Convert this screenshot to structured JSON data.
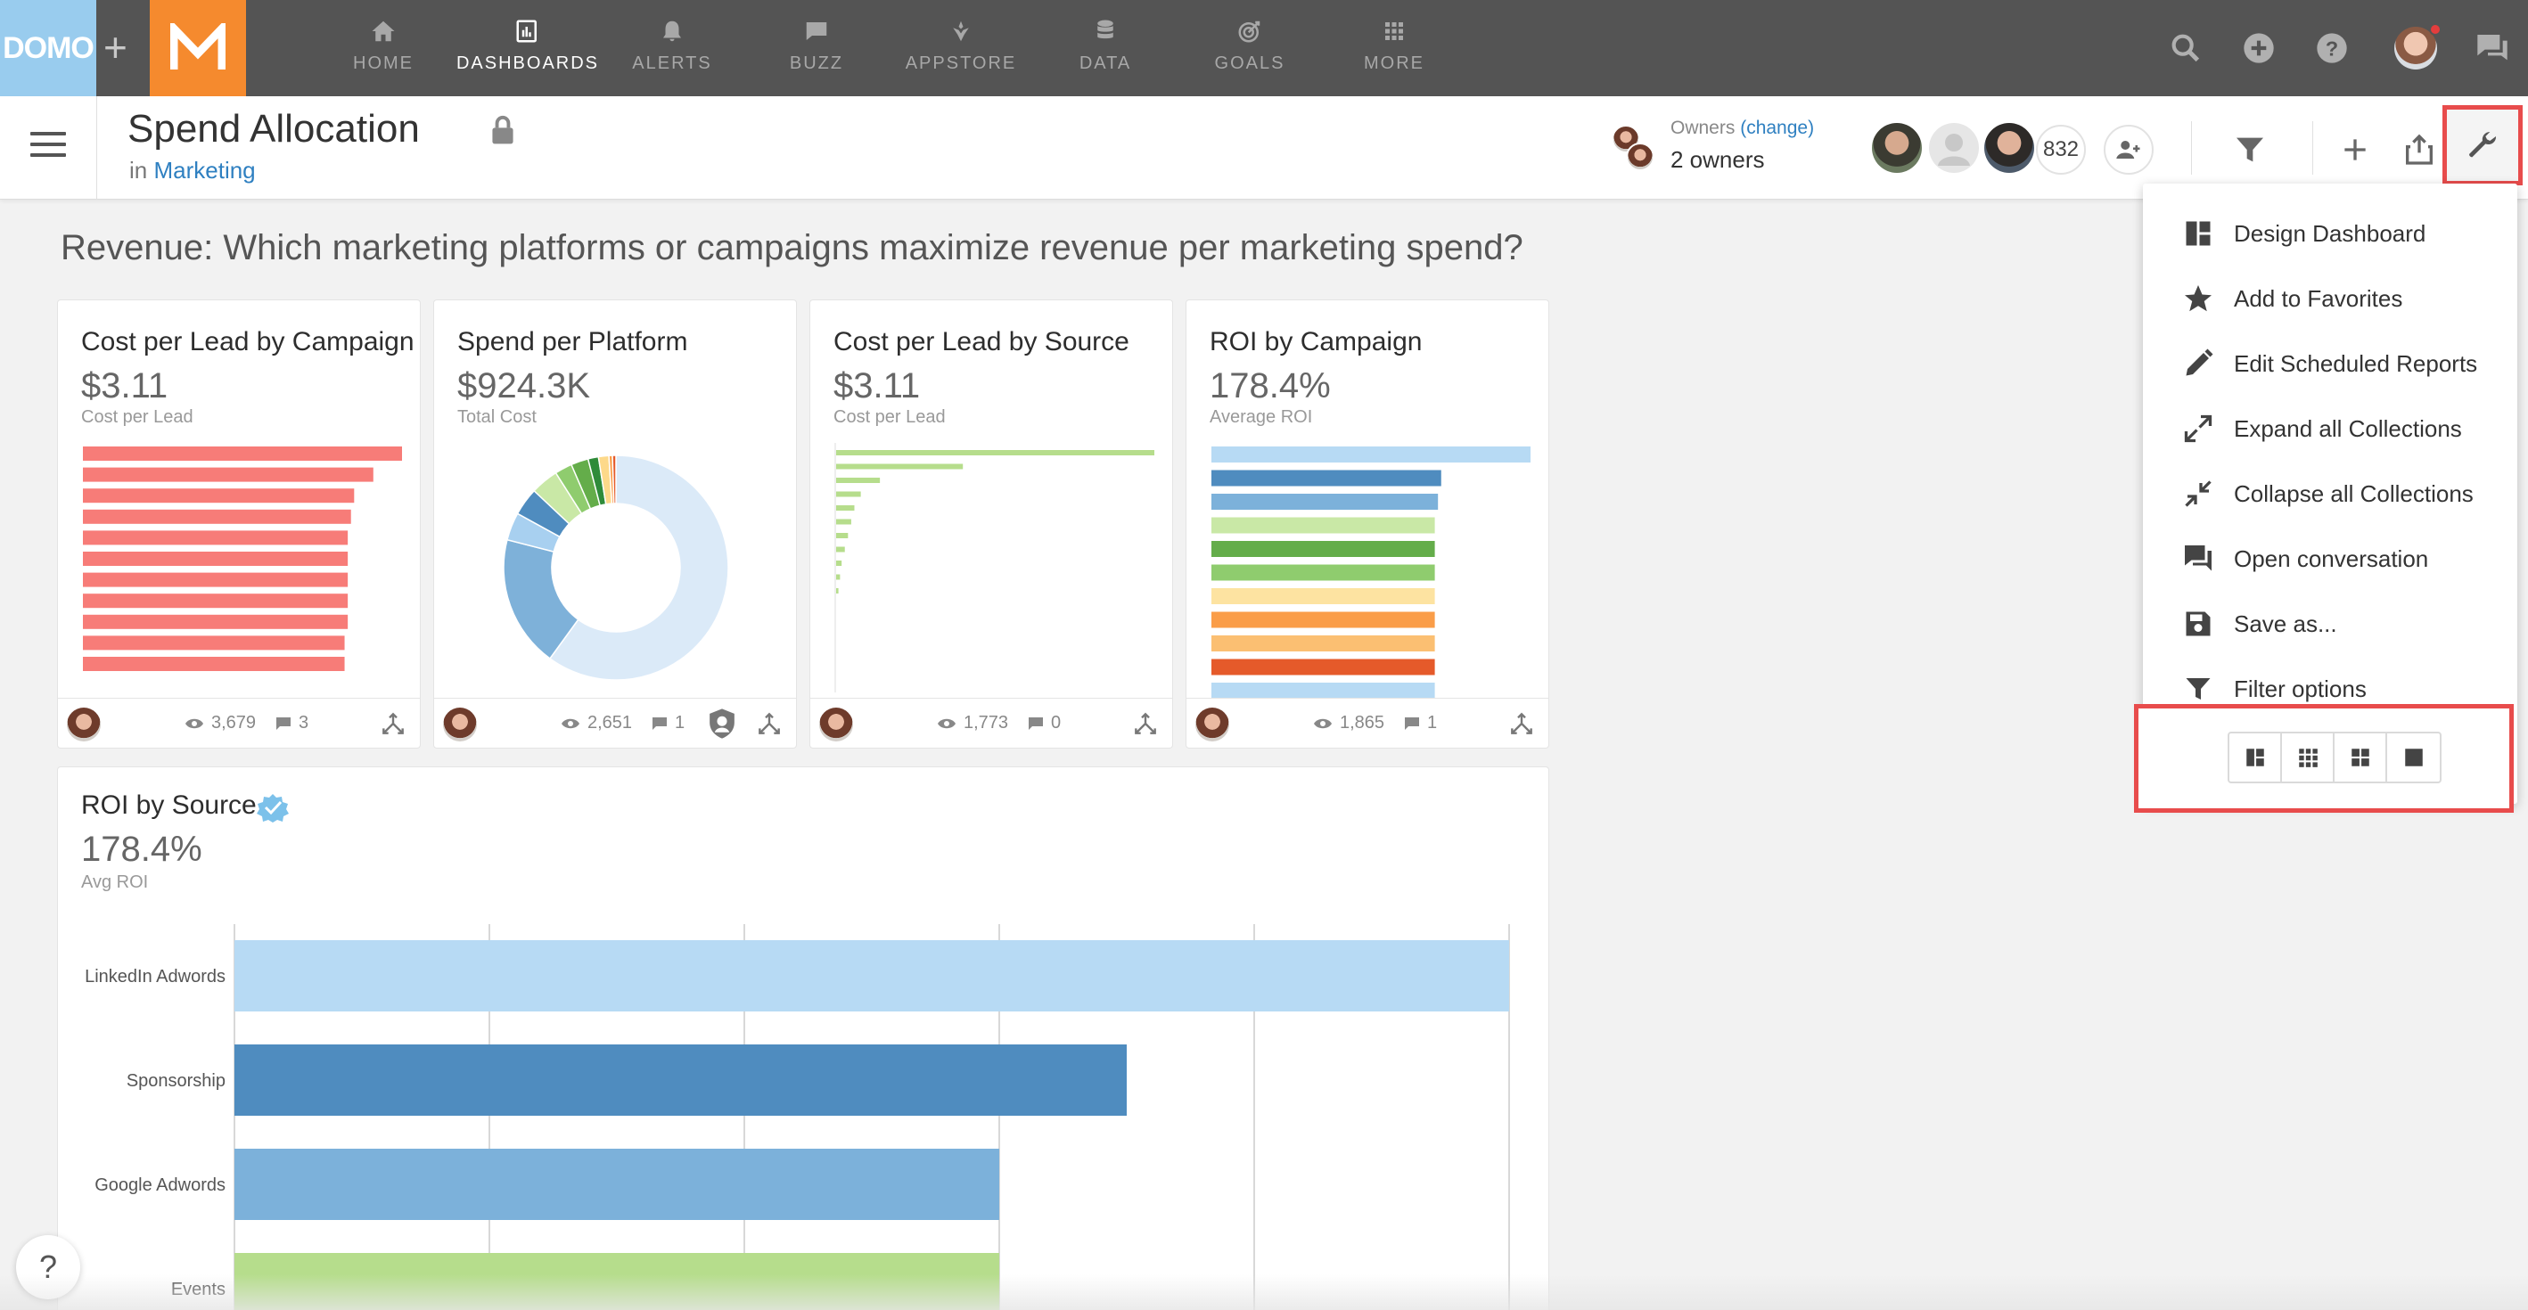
{
  "topnav": {
    "domo_logo": "DOMO",
    "plus": "+",
    "items": [
      {
        "label": "HOME",
        "icon": "home-icon"
      },
      {
        "label": "DASHBOARDS",
        "icon": "dashboards-icon",
        "active": true
      },
      {
        "label": "ALERTS",
        "icon": "bell-icon"
      },
      {
        "label": "BUZZ",
        "icon": "chat-icon"
      },
      {
        "label": "APPSTORE",
        "icon": "appstore-icon"
      },
      {
        "label": "DATA",
        "icon": "database-icon"
      },
      {
        "label": "GOALS",
        "icon": "target-icon"
      },
      {
        "label": "MORE",
        "icon": "grid-icon"
      }
    ],
    "right_icons": [
      "search-icon",
      "add-circle-icon",
      "help-icon",
      "avatar",
      "chat-icon"
    ]
  },
  "page": {
    "title": "Spend Allocation",
    "in_prefix": "in",
    "in_link": "Marketing",
    "owners_label": "Owners",
    "owners_change": "(change)",
    "owners_count": "2 owners",
    "share_count": "832",
    "headline": "Revenue: Which marketing platforms or campaigns maximize revenue per marketing spend?"
  },
  "cards": [
    {
      "title": "Cost per Lead by Campaign",
      "value": "$3.11",
      "sub": "Cost per Lead",
      "views": "3,679",
      "comments": "3"
    },
    {
      "title": "Spend per Platform",
      "value": "$924.3K",
      "sub": "Total Cost",
      "views": "2,651",
      "comments": "1"
    },
    {
      "title": "Cost per Lead by Source",
      "value": "$3.11",
      "sub": "Cost per Lead",
      "views": "1,773",
      "comments": "0"
    },
    {
      "title": "ROI by Campaign",
      "value": "178.4%",
      "sub": "Average ROI",
      "views": "1,865",
      "comments": "1"
    }
  ],
  "big_card": {
    "title": "ROI by Source",
    "value": "178.4%",
    "sub": "Avg ROI"
  },
  "menu": {
    "items": [
      {
        "label": "Design Dashboard",
        "icon": "design-dashboard-icon"
      },
      {
        "label": "Add to Favorites",
        "icon": "star-icon"
      },
      {
        "label": "Edit Scheduled Reports",
        "icon": "pencil-icon"
      },
      {
        "label": "Expand all Collections",
        "icon": "expand-icon"
      },
      {
        "label": "Collapse all Collections",
        "icon": "collapse-icon"
      },
      {
        "label": "Open conversation",
        "icon": "conversation-icon"
      },
      {
        "label": "Save as...",
        "icon": "save-icon"
      },
      {
        "label": "Filter options",
        "icon": "filter-icon"
      }
    ],
    "layout_buttons": [
      "layout-mixed-icon",
      "layout-small-grid-icon",
      "layout-medium-grid-icon",
      "layout-large-icon"
    ]
  },
  "help_fab": "?",
  "colors": {
    "nav_bg": "#545454",
    "domo_blue": "#99ccee",
    "m_orange": "#f58a2e",
    "link_blue": "#2f80c1",
    "highlight_red": "#e84c4c"
  },
  "chart_data": [
    {
      "type": "bar",
      "orientation": "horizontal",
      "title": "Cost per Lead by Campaign",
      "values": [
        100,
        91,
        85,
        84,
        83,
        83,
        83,
        83,
        83,
        82,
        82
      ],
      "color": "#f77c78"
    },
    {
      "type": "pie",
      "donut": true,
      "title": "Spend per Platform",
      "values": [
        60.0,
        19.0,
        4.0,
        4.0,
        4.0,
        2.5,
        2.5,
        1.5,
        1.5,
        0.5,
        0.5
      ],
      "colors": [
        "#dbeaf8",
        "#7eb1d9",
        "#a8d0f0",
        "#4f8cbf",
        "#c9e8a6",
        "#8fcc6e",
        "#64ad4a",
        "#2f8b3a",
        "#fdd98a",
        "#fa9d48",
        "#e55a2a"
      ]
    },
    {
      "type": "bar",
      "orientation": "horizontal",
      "title": "Cost per Lead by Source",
      "values": [
        100,
        40,
        14,
        8,
        6,
        5,
        4,
        3,
        2,
        1.5,
        1
      ],
      "color": "#b6dd8c"
    },
    {
      "type": "bar",
      "orientation": "horizontal",
      "title": "ROI by Campaign",
      "values": [
        100,
        72,
        71,
        70,
        70,
        70,
        70,
        70,
        70,
        70,
        70
      ],
      "colors": [
        "#b7daf4",
        "#4f8cbf",
        "#7cb1da",
        "#c9e8a6",
        "#64ad4a",
        "#8fcc6e",
        "#fde3a1",
        "#fa9d48",
        "#fbbf72",
        "#e55a2a"
      ]
    },
    {
      "type": "bar",
      "orientation": "horizontal",
      "title": "ROI by Source",
      "categories": [
        "LinkedIn Adwords",
        "Sponsorship",
        "Google Adwords",
        "Events"
      ],
      "values": [
        100,
        70,
        60,
        60
      ],
      "colors": [
        "#b7daf4",
        "#4f8cbf",
        "#7cb1da",
        "#b6dd8c"
      ],
      "grid": true
    }
  ]
}
